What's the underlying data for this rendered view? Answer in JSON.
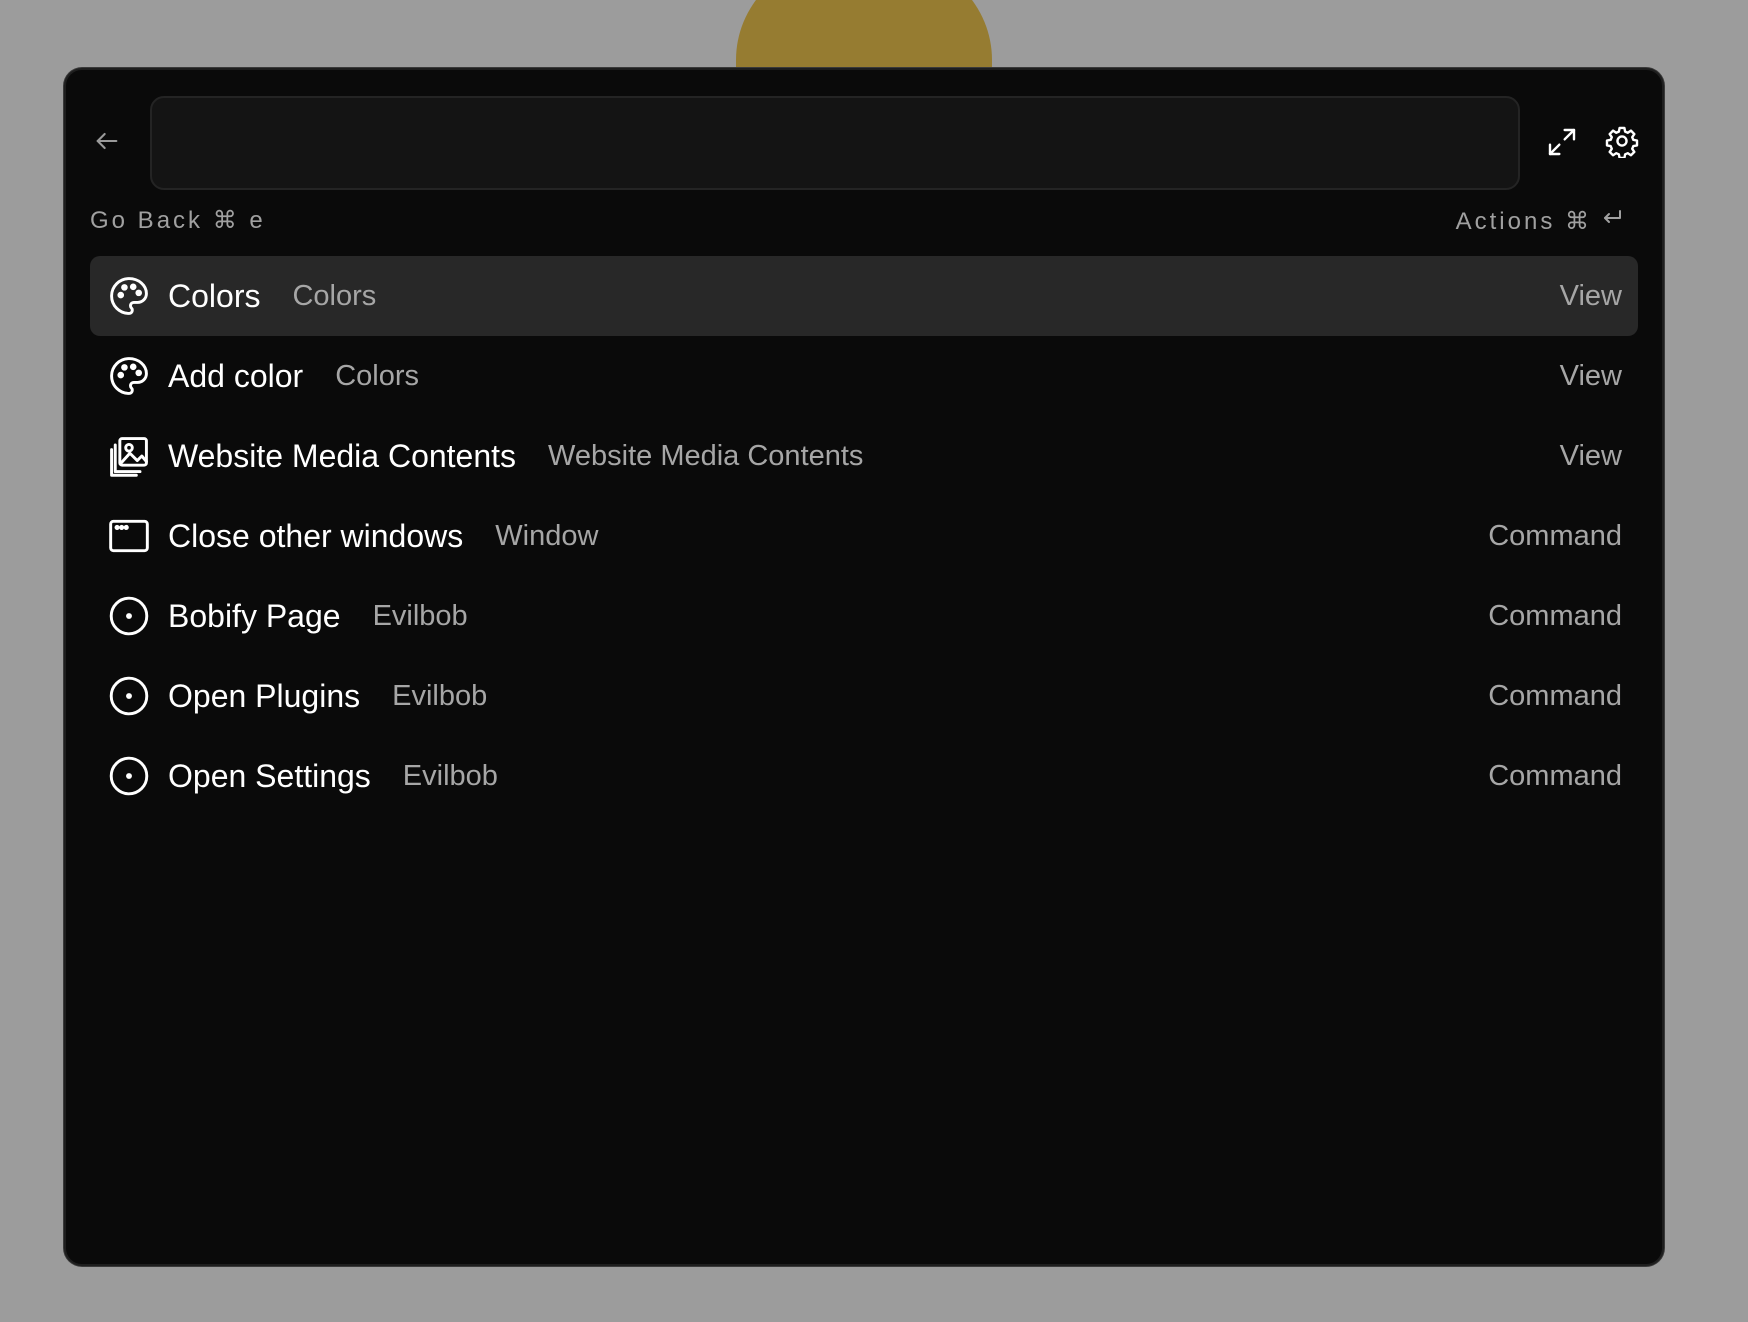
{
  "search": {
    "placeholder": "",
    "value": ""
  },
  "hints": {
    "go_back": "Go Back ⌘ e",
    "actions": "Actions ⌘"
  },
  "items": [
    {
      "title": "Colors",
      "subtitle": "Colors",
      "type": "View",
      "icon": "palette-icon",
      "selected": true
    },
    {
      "title": "Add color",
      "subtitle": "Colors",
      "type": "View",
      "icon": "palette-icon",
      "selected": false
    },
    {
      "title": "Website Media Contents",
      "subtitle": "Website Media Contents",
      "type": "View",
      "icon": "media-gallery-icon",
      "selected": false
    },
    {
      "title": "Close other windows",
      "subtitle": "Window",
      "type": "Command",
      "icon": "window-icon",
      "selected": false
    },
    {
      "title": "Bobify Page",
      "subtitle": "Evilbob",
      "type": "Command",
      "icon": "dot-circle-icon",
      "selected": false
    },
    {
      "title": "Open Plugins",
      "subtitle": "Evilbob",
      "type": "Command",
      "icon": "dot-circle-icon",
      "selected": false
    },
    {
      "title": "Open Settings",
      "subtitle": "Evilbob",
      "type": "Command",
      "icon": "dot-circle-icon",
      "selected": false
    }
  ],
  "colors": {
    "background": "#9c9c9c",
    "panel": "#0a0a0a",
    "selected_row": "#282828",
    "accent_blob": "#967c31"
  }
}
